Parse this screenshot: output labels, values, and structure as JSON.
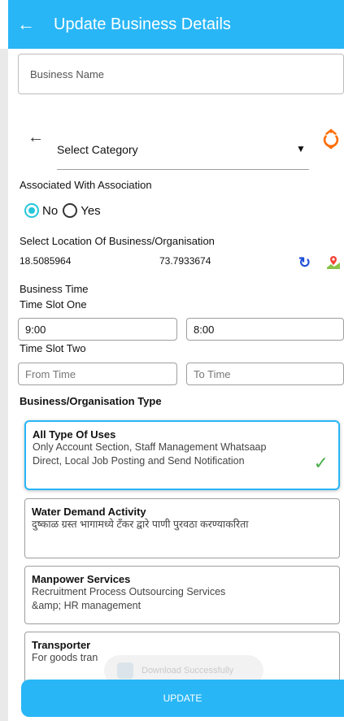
{
  "header": {
    "title": "Update Business Details"
  },
  "form": {
    "business_name_placeholder": "Business Name",
    "category": {
      "value": "Select Category"
    },
    "association": {
      "label": "Associated With Association",
      "options": [
        {
          "label": "No",
          "selected": true
        },
        {
          "label": "Yes",
          "selected": false
        }
      ]
    },
    "location": {
      "label": "Select Location Of Business/Organisation",
      "latitude": "18.5085964",
      "longitude": "73.7933674"
    },
    "business_time": {
      "label": "Business Time",
      "slot_one": {
        "label": "Time Slot One",
        "from": "9:00",
        "to": "8:00"
      },
      "slot_two": {
        "label": "Time Slot Two",
        "from_placeholder": "From Time",
        "to_placeholder": "To Time"
      }
    },
    "org_type": {
      "label": "Business/Organisation Type",
      "options": [
        {
          "title": "All Type Of Uses",
          "desc": "Only Account Section, Staff Management Whatsaap Direct, Local Job Posting and Send Notification",
          "selected": true
        },
        {
          "title": "Water Demand Activity",
          "desc": "दुष्काळ ग्रस्त भागामध्ये टँकर द्वारे पाणी पुरवठा करण्याकरिता",
          "selected": false
        },
        {
          "title": "Manpower Services",
          "desc": "Recruitment Process Outsourcing Services &amp; HR management",
          "selected": false
        },
        {
          "title": "Transporter",
          "desc": "For goods tran",
          "selected": false
        }
      ]
    }
  },
  "toast": {
    "text": "Download Successfully"
  },
  "actions": {
    "update_label": "UPDATE"
  },
  "colors": {
    "primary": "#29b6f6",
    "radio_accent": "#26c6da",
    "check": "#4caf50",
    "refresh": "#ff6d00",
    "reload": "#1e4fd8"
  },
  "icons": [
    "back-arrow-icon",
    "chevron-down-icon",
    "refresh-icon",
    "reload-icon",
    "map-pin-icon",
    "check-icon",
    "app-icon"
  ]
}
